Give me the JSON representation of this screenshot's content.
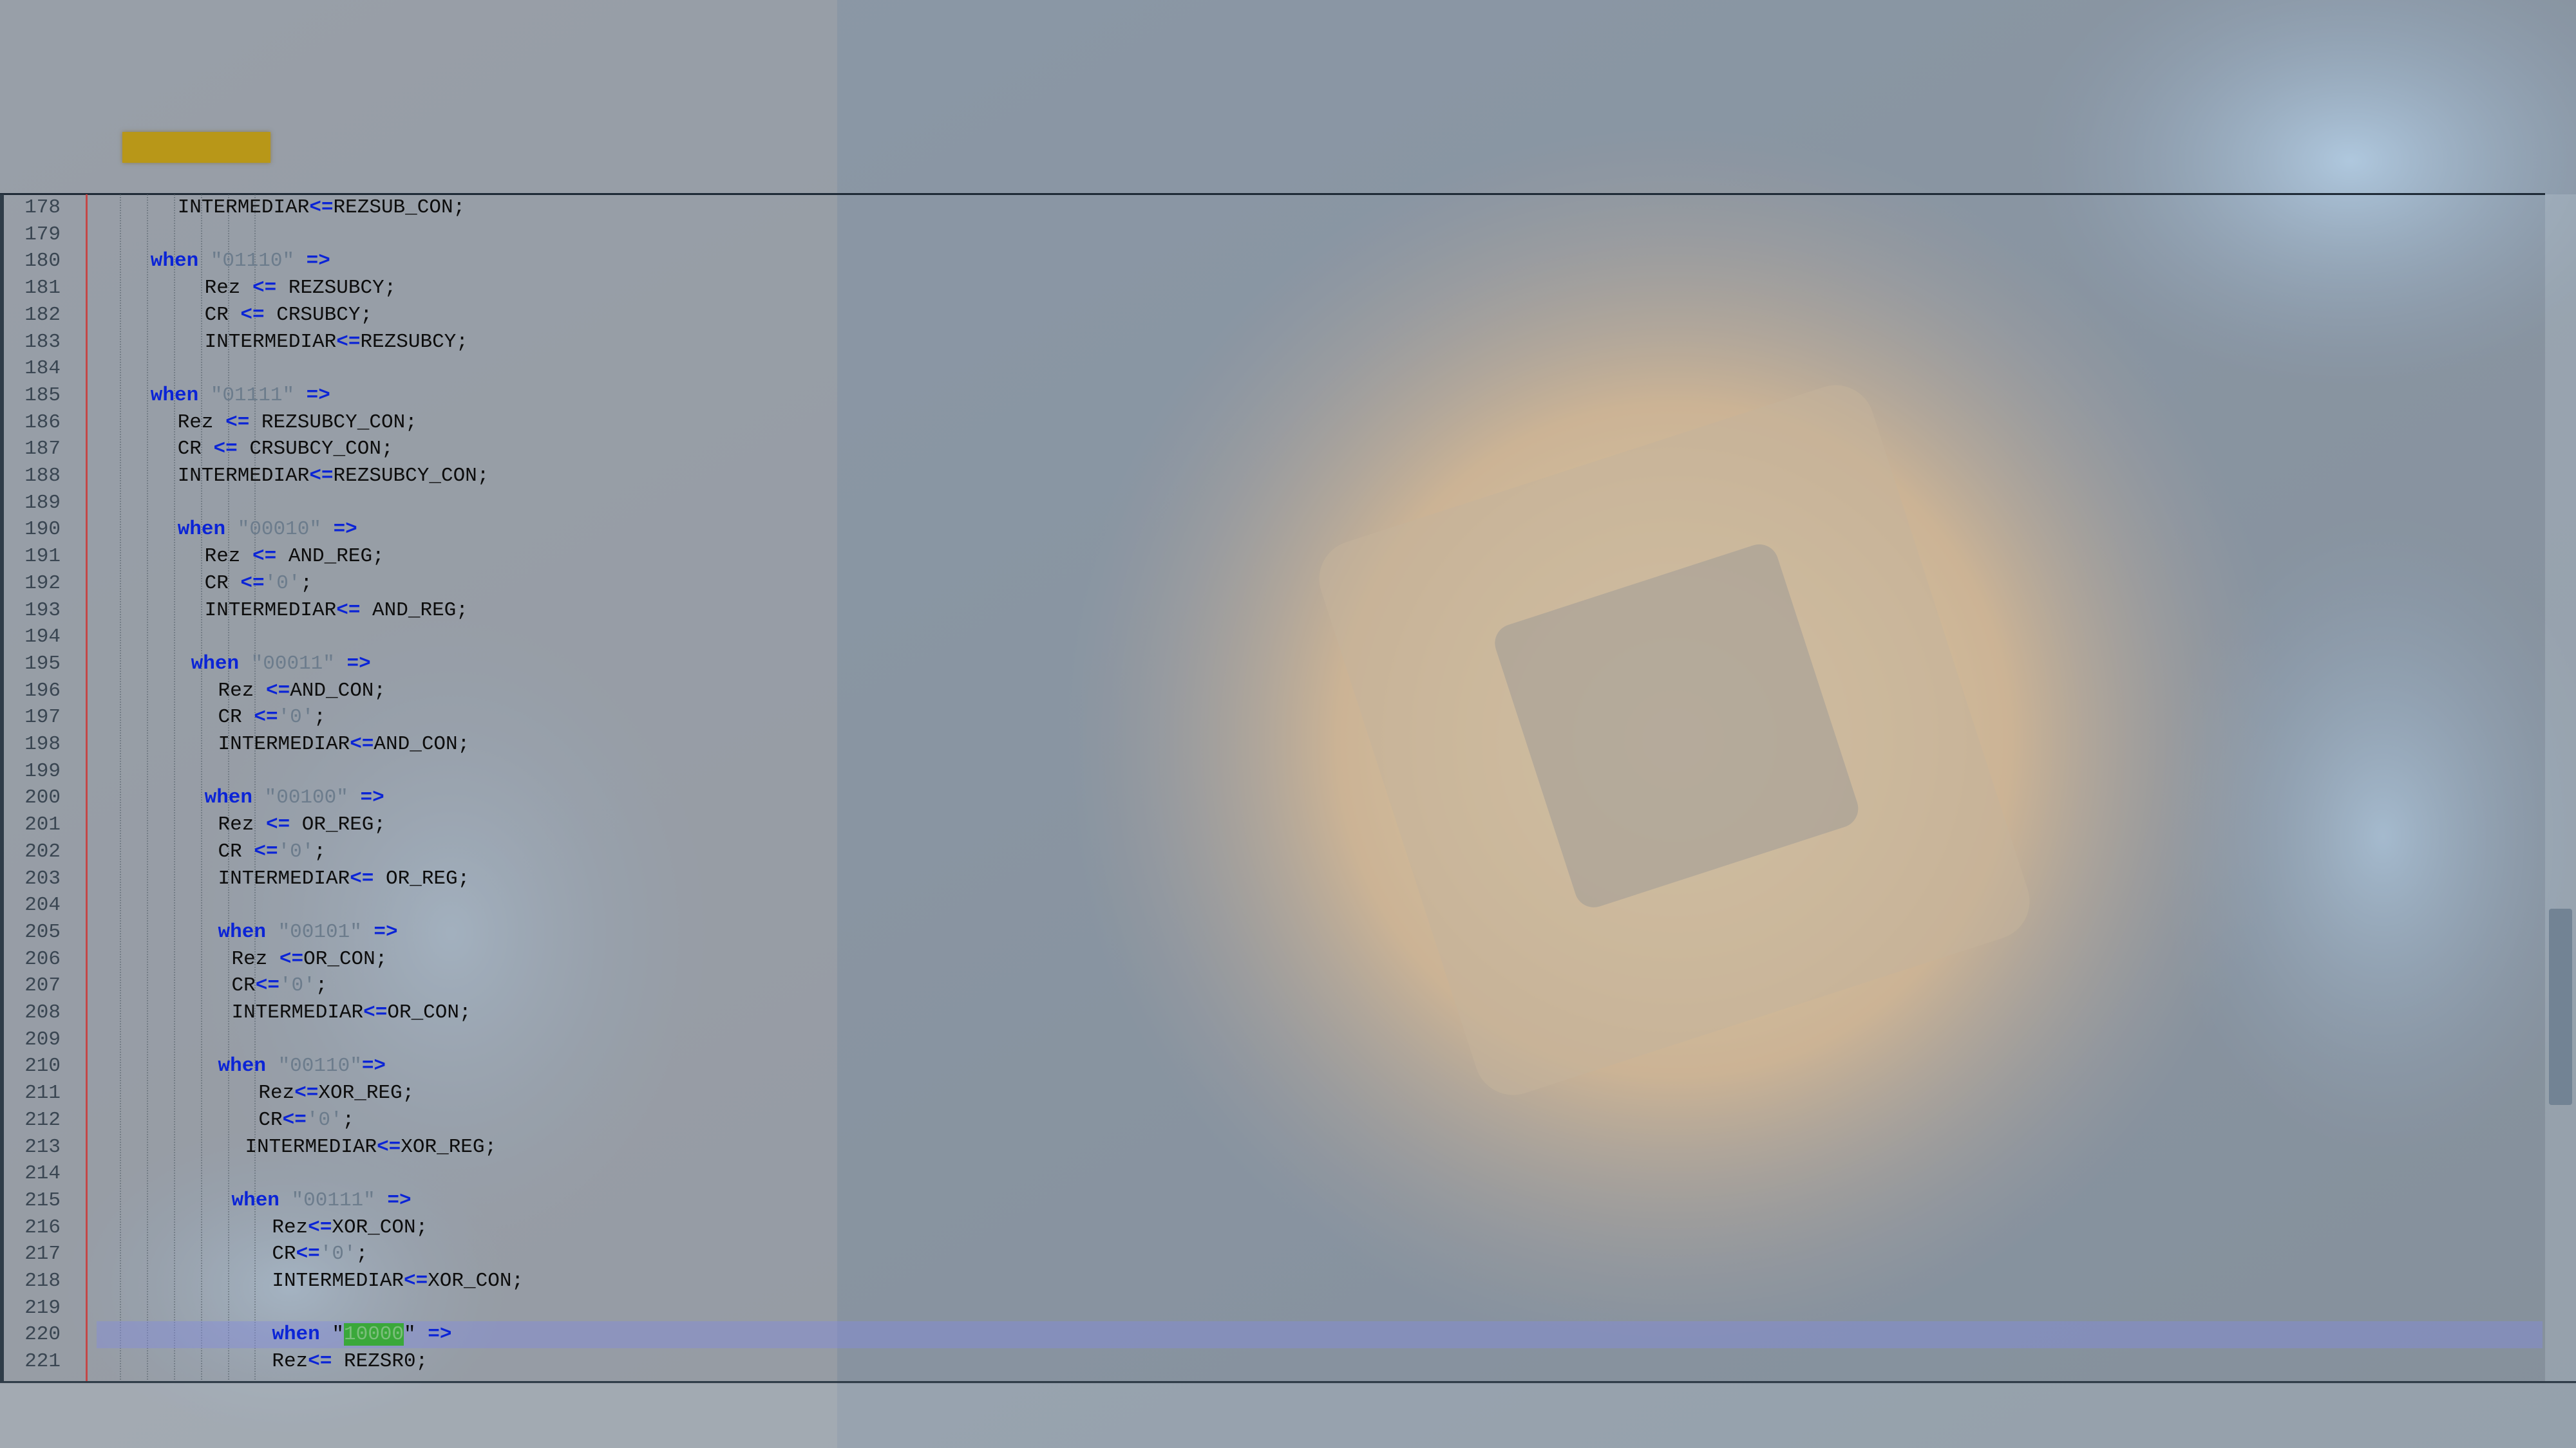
{
  "colors": {
    "accent_tab": "#b89718",
    "keyword": "#0b24d6",
    "string": "#6c7c8c",
    "highlight": "#3aa83a"
  },
  "editor": {
    "lines": [
      {
        "n": "178",
        "ind": 3,
        "segs": [
          [
            "t",
            "INTERMEDIAR"
          ],
          [
            "o",
            "<="
          ],
          [
            "t",
            "REZSUB_CON;"
          ]
        ]
      },
      {
        "n": "179",
        "ind": 0,
        "segs": []
      },
      {
        "n": "180",
        "ind": 2,
        "segs": [
          [
            "k",
            "when"
          ],
          [
            "t",
            " "
          ],
          [
            "s",
            "\"01110\""
          ],
          [
            "t",
            " "
          ],
          [
            "o",
            "=>"
          ]
        ]
      },
      {
        "n": "181",
        "ind": 4,
        "segs": [
          [
            "t",
            "Rez "
          ],
          [
            "o",
            "<="
          ],
          [
            "t",
            " REZSUBCY;"
          ]
        ]
      },
      {
        "n": "182",
        "ind": 4,
        "segs": [
          [
            "t",
            "CR "
          ],
          [
            "o",
            "<="
          ],
          [
            "t",
            " CRSUBCY;"
          ]
        ]
      },
      {
        "n": "183",
        "ind": 4,
        "segs": [
          [
            "t",
            "INTERMEDIAR"
          ],
          [
            "o",
            "<="
          ],
          [
            "t",
            "REZSUBCY;"
          ]
        ]
      },
      {
        "n": "184",
        "ind": 0,
        "segs": []
      },
      {
        "n": "185",
        "ind": 2,
        "segs": [
          [
            "k",
            "when"
          ],
          [
            "t",
            " "
          ],
          [
            "s",
            "\"01111\""
          ],
          [
            "t",
            " "
          ],
          [
            "o",
            "=>"
          ]
        ]
      },
      {
        "n": "186",
        "ind": 3,
        "segs": [
          [
            "t",
            "Rez "
          ],
          [
            "o",
            "<="
          ],
          [
            "t",
            " REZSUBCY_CON;"
          ]
        ]
      },
      {
        "n": "187",
        "ind": 3,
        "segs": [
          [
            "t",
            "CR "
          ],
          [
            "o",
            "<="
          ],
          [
            "t",
            " CRSUBCY_CON;"
          ]
        ]
      },
      {
        "n": "188",
        "ind": 3,
        "segs": [
          [
            "t",
            "INTERMEDIAR"
          ],
          [
            "o",
            "<="
          ],
          [
            "t",
            "REZSUBCY_CON;"
          ]
        ]
      },
      {
        "n": "189",
        "ind": 0,
        "segs": []
      },
      {
        "n": "190",
        "ind": 3,
        "segs": [
          [
            "k",
            "when"
          ],
          [
            "t",
            " "
          ],
          [
            "s",
            "\"00010\""
          ],
          [
            "t",
            " "
          ],
          [
            "o",
            "=>"
          ]
        ]
      },
      {
        "n": "191",
        "ind": 4,
        "segs": [
          [
            "t",
            "Rez "
          ],
          [
            "o",
            "<="
          ],
          [
            "t",
            " AND_REG;"
          ]
        ]
      },
      {
        "n": "192",
        "ind": 4,
        "segs": [
          [
            "t",
            "CR "
          ],
          [
            "o",
            "<="
          ],
          [
            "s",
            "'0'"
          ],
          [
            "t",
            ";"
          ]
        ]
      },
      {
        "n": "193",
        "ind": 4,
        "segs": [
          [
            "t",
            "INTERMEDIAR"
          ],
          [
            "o",
            "<="
          ],
          [
            "t",
            " AND_REG;"
          ]
        ]
      },
      {
        "n": "194",
        "ind": 0,
        "segs": []
      },
      {
        "n": "195",
        "ind": 3.5,
        "segs": [
          [
            "k",
            "when"
          ],
          [
            "t",
            " "
          ],
          [
            "s",
            "\"00011\""
          ],
          [
            "t",
            " "
          ],
          [
            "o",
            "=>"
          ]
        ]
      },
      {
        "n": "196",
        "ind": 4.5,
        "segs": [
          [
            "t",
            "Rez "
          ],
          [
            "o",
            "<="
          ],
          [
            "t",
            "AND_CON;"
          ]
        ]
      },
      {
        "n": "197",
        "ind": 4.5,
        "segs": [
          [
            "t",
            "CR "
          ],
          [
            "o",
            "<="
          ],
          [
            "s",
            "'0'"
          ],
          [
            "t",
            ";"
          ]
        ]
      },
      {
        "n": "198",
        "ind": 4.5,
        "segs": [
          [
            "t",
            "INTERMEDIAR"
          ],
          [
            "o",
            "<="
          ],
          [
            "t",
            "AND_CON;"
          ]
        ]
      },
      {
        "n": "199",
        "ind": 0,
        "segs": []
      },
      {
        "n": "200",
        "ind": 4,
        "segs": [
          [
            "k",
            "when"
          ],
          [
            "t",
            " "
          ],
          [
            "s",
            "\"00100\""
          ],
          [
            "t",
            " "
          ],
          [
            "o",
            "=>"
          ]
        ]
      },
      {
        "n": "201",
        "ind": 4.5,
        "segs": [
          [
            "t",
            "Rez "
          ],
          [
            "o",
            "<="
          ],
          [
            "t",
            " OR_REG;"
          ]
        ]
      },
      {
        "n": "202",
        "ind": 4.5,
        "segs": [
          [
            "t",
            "CR "
          ],
          [
            "o",
            "<="
          ],
          [
            "s",
            "'0'"
          ],
          [
            "t",
            ";"
          ]
        ]
      },
      {
        "n": "203",
        "ind": 4.5,
        "segs": [
          [
            "t",
            "INTERMEDIAR"
          ],
          [
            "o",
            "<="
          ],
          [
            "t",
            " OR_REG;"
          ]
        ]
      },
      {
        "n": "204",
        "ind": 0,
        "segs": []
      },
      {
        "n": "205",
        "ind": 4.5,
        "segs": [
          [
            "k",
            "when"
          ],
          [
            "t",
            " "
          ],
          [
            "s",
            "\"00101\""
          ],
          [
            "t",
            " "
          ],
          [
            "o",
            "=>"
          ]
        ]
      },
      {
        "n": "206",
        "ind": 5,
        "segs": [
          [
            "t",
            "Rez "
          ],
          [
            "o",
            "<="
          ],
          [
            "t",
            "OR_CON;"
          ]
        ]
      },
      {
        "n": "207",
        "ind": 5,
        "segs": [
          [
            "t",
            "CR"
          ],
          [
            "o",
            "<="
          ],
          [
            "s",
            "'0'"
          ],
          [
            "t",
            ";"
          ]
        ]
      },
      {
        "n": "208",
        "ind": 5,
        "segs": [
          [
            "t",
            "INTERMEDIAR"
          ],
          [
            "o",
            "<="
          ],
          [
            "t",
            "OR_CON;"
          ]
        ]
      },
      {
        "n": "209",
        "ind": 0,
        "segs": []
      },
      {
        "n": "210",
        "ind": 4.5,
        "segs": [
          [
            "k",
            "when"
          ],
          [
            "t",
            " "
          ],
          [
            "s",
            "\"00110\""
          ],
          [
            "o",
            "=>"
          ]
        ]
      },
      {
        "n": "211",
        "ind": 6,
        "segs": [
          [
            "t",
            "Rez"
          ],
          [
            "o",
            "<="
          ],
          [
            "t",
            "XOR_REG;"
          ]
        ]
      },
      {
        "n": "212",
        "ind": 6,
        "segs": [
          [
            "t",
            "CR"
          ],
          [
            "o",
            "<="
          ],
          [
            "s",
            "'0'"
          ],
          [
            "t",
            ";"
          ]
        ]
      },
      {
        "n": "213",
        "ind": 5.5,
        "segs": [
          [
            "t",
            "INTERMEDIAR"
          ],
          [
            "o",
            "<="
          ],
          [
            "t",
            "XOR_REG;"
          ]
        ]
      },
      {
        "n": "214",
        "ind": 0,
        "segs": []
      },
      {
        "n": "215",
        "ind": 5,
        "segs": [
          [
            "k",
            "when"
          ],
          [
            "t",
            " "
          ],
          [
            "s",
            "\"00111\""
          ],
          [
            "t",
            " "
          ],
          [
            "o",
            "=>"
          ]
        ]
      },
      {
        "n": "216",
        "ind": 6.5,
        "segs": [
          [
            "t",
            "Rez"
          ],
          [
            "o",
            "<="
          ],
          [
            "t",
            "XOR_CON;"
          ]
        ]
      },
      {
        "n": "217",
        "ind": 6.5,
        "segs": [
          [
            "t",
            "CR"
          ],
          [
            "o",
            "<="
          ],
          [
            "s",
            "'0'"
          ],
          [
            "t",
            ";"
          ]
        ]
      },
      {
        "n": "218",
        "ind": 6.5,
        "segs": [
          [
            "t",
            "INTERMEDIAR"
          ],
          [
            "o",
            "<="
          ],
          [
            "t",
            "XOR_CON;"
          ]
        ]
      },
      {
        "n": "219",
        "ind": 0,
        "segs": []
      },
      {
        "n": "220",
        "ind": 6.5,
        "hl": true,
        "segs": [
          [
            "k",
            "when"
          ],
          [
            "t",
            " \""
          ],
          [
            "h",
            "10000"
          ],
          [
            "t",
            "\" "
          ],
          [
            "o",
            "=>"
          ]
        ]
      },
      {
        "n": "221",
        "ind": 6.5,
        "segs": [
          [
            "t",
            "Rez"
          ],
          [
            "o",
            "<="
          ],
          [
            "t",
            " REZSR0;"
          ]
        ]
      }
    ]
  }
}
